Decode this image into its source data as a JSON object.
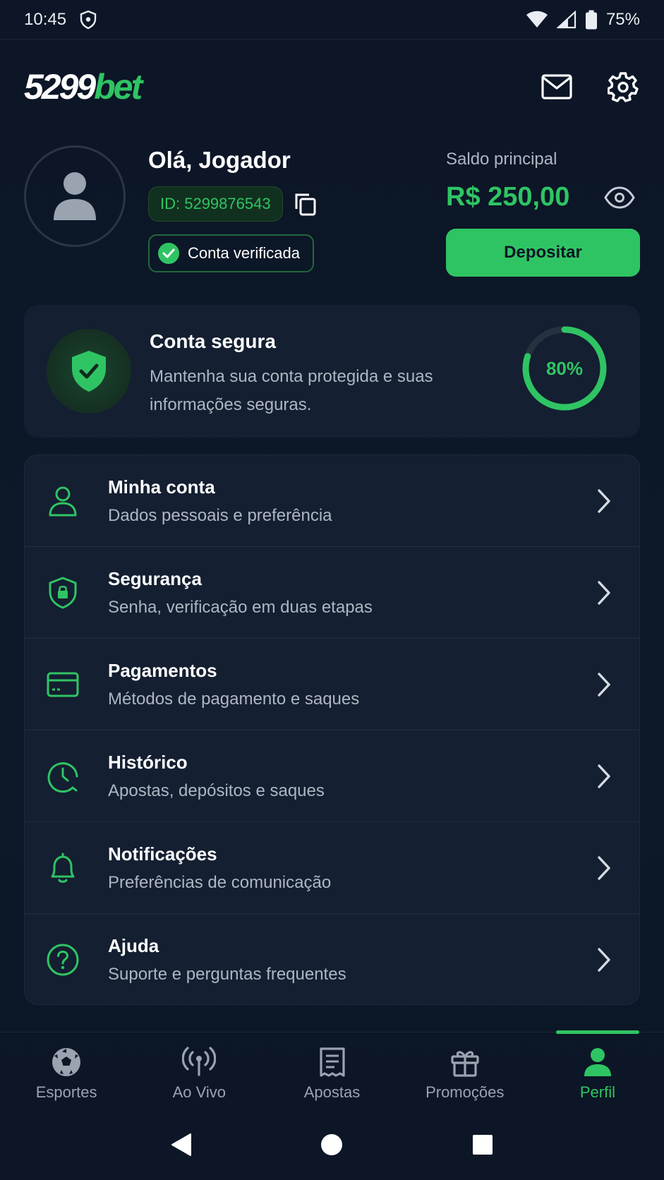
{
  "status_bar": {
    "time": "10:45",
    "battery": "75%",
    "icons": [
      "shield-icon",
      "wifi-icon",
      "signal-icon",
      "battery-icon"
    ]
  },
  "header": {
    "logo_number": "5299",
    "logo_brand": "bet",
    "icons": [
      "mail-icon",
      "gear-icon"
    ]
  },
  "profile": {
    "greeting": "Olá, Jogador",
    "id_label": "ID: 5299876543",
    "verified_label": "Conta verificada",
    "balance_label": "Saldo principal",
    "balance_value": "R$ 250,00",
    "deposit_label": "Depositar"
  },
  "security": {
    "title": "Conta segura",
    "description": "Mantenha sua conta protegida e suas informações seguras.",
    "progress_label": "80%",
    "progress": 0.8
  },
  "menu": {
    "items": [
      {
        "title": "Minha conta",
        "subtitle": "Dados pessoais e preferência",
        "icon": "user-icon"
      },
      {
        "title": "Segurança",
        "subtitle": "Senha, verificação em duas etapas",
        "icon": "shield-lock-icon"
      },
      {
        "title": "Pagamentos",
        "subtitle": "Métodos de pagamento e saques",
        "icon": "card-icon"
      },
      {
        "title": "Histórico",
        "subtitle": "Apostas, depósitos e saques",
        "icon": "history-icon"
      },
      {
        "title": "Notificações",
        "subtitle": "Preferências de comunicação",
        "icon": "bell-icon"
      },
      {
        "title": "Ajuda",
        "subtitle": "Suporte e perguntas frequentes",
        "icon": "help-icon"
      }
    ]
  },
  "bottom_nav": {
    "items": [
      {
        "label": "Esportes",
        "icon": "soccer-ball-icon"
      },
      {
        "label": "Ao Vivo",
        "icon": "live-broadcast-icon"
      },
      {
        "label": "Apostas",
        "icon": "bet-slip-icon"
      },
      {
        "label": "Promoções",
        "icon": "gift-icon"
      },
      {
        "label": "Perfil",
        "icon": "profile-icon"
      }
    ],
    "active": "Perfil"
  },
  "colors": {
    "accent": "#2fc463",
    "background": "#0c1626",
    "card": "#141f31",
    "muted_text": "#aeb6c2"
  }
}
